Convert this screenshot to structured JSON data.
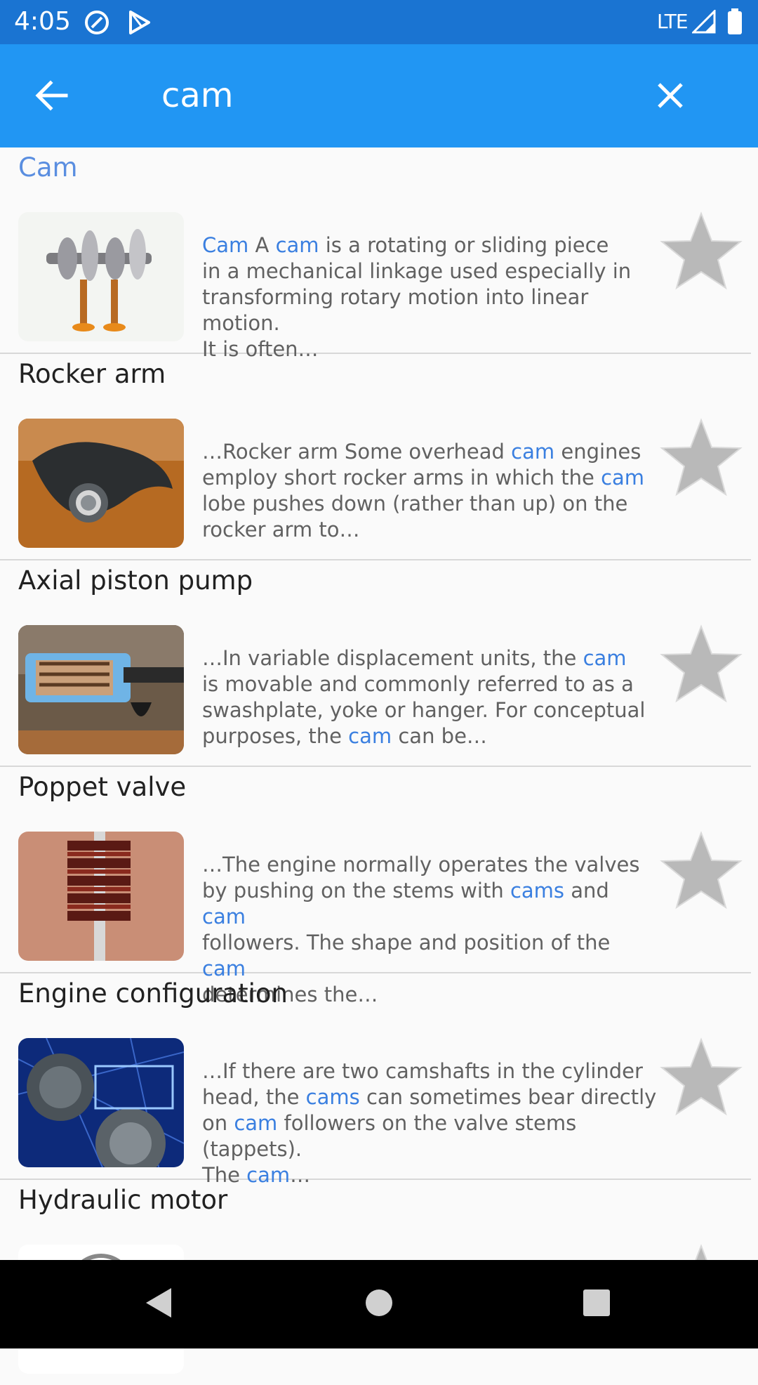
{
  "status": {
    "time": "4:05",
    "network": "LTE"
  },
  "search": {
    "value": "cam"
  },
  "results": [
    {
      "title": "Cam",
      "title_accent": true,
      "snippet": [
        {
          "t": "Cam",
          "h": true
        },
        {
          "t": " A ",
          "h": false
        },
        {
          "t": "cam",
          "h": true
        },
        {
          "t": " is a rotating or sliding piece\nin a mechanical linkage used especially in\ntransforming rotary motion into linear motion.\nIt is often…",
          "h": false
        }
      ]
    },
    {
      "title": "Rocker arm",
      "snippet": [
        {
          "t": "…Rocker arm Some overhead ",
          "h": false
        },
        {
          "t": "cam",
          "h": true
        },
        {
          "t": " engines\nemploy short rocker arms in which the ",
          "h": false
        },
        {
          "t": "cam",
          "h": true
        },
        {
          "t": "\nlobe pushes down (rather than up) on the\nrocker arm to…",
          "h": false
        }
      ]
    },
    {
      "title": "Axial piston pump",
      "snippet": [
        {
          "t": "…In variable displacement units, the ",
          "h": false
        },
        {
          "t": "cam",
          "h": true
        },
        {
          "t": "\nis movable and commonly referred to as a\nswashplate, yoke or hanger. For conceptual\npurposes, the ",
          "h": false
        },
        {
          "t": "cam",
          "h": true
        },
        {
          "t": " can be…",
          "h": false
        }
      ]
    },
    {
      "title": "Poppet valve",
      "snippet": [
        {
          "t": "…The engine normally operates the valves\nby pushing on the stems with ",
          "h": false
        },
        {
          "t": "cams",
          "h": true
        },
        {
          "t": " and ",
          "h": false
        },
        {
          "t": "cam",
          "h": true
        },
        {
          "t": "\nfollowers. The shape and position of the ",
          "h": false
        },
        {
          "t": "cam",
          "h": true
        },
        {
          "t": "\ndetermines the…",
          "h": false
        }
      ]
    },
    {
      "title": "Engine configuration",
      "snippet": [
        {
          "t": "…If there are two camshafts in the cylinder\nhead, the ",
          "h": false
        },
        {
          "t": "cams",
          "h": true
        },
        {
          "t": " can sometimes bear directly\non ",
          "h": false
        },
        {
          "t": "cam",
          "h": true
        },
        {
          "t": " followers on the valve stems (tappets).\nThe ",
          "h": false
        },
        {
          "t": "cam",
          "h": true
        },
        {
          "t": "…",
          "h": false
        }
      ]
    },
    {
      "title": "Hydraulic motor",
      "snippet": []
    }
  ],
  "icons": {
    "back": "arrow-left-icon",
    "clear": "close-icon",
    "favorite": "star-icon",
    "nav_back": "triangle-back-icon",
    "nav_home": "circle-home-icon",
    "nav_recents": "square-recents-icon"
  },
  "colors": {
    "status_bar": "#1a74d2",
    "app_bar": "#2196f3",
    "highlight": "#3a7fe0",
    "title_accent": "#5a8ee0"
  }
}
